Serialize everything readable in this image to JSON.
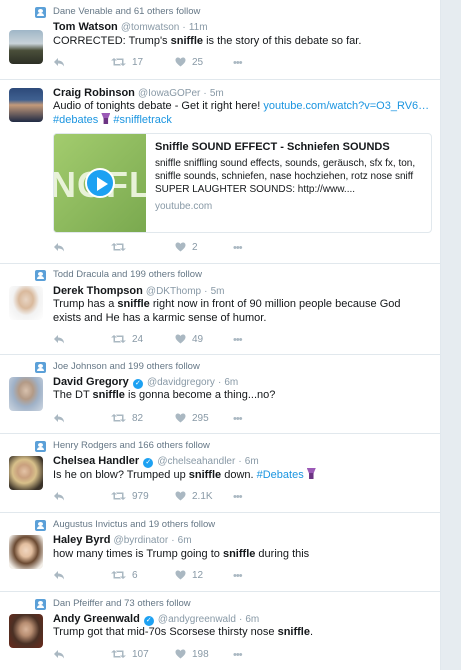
{
  "tweets": [
    {
      "context": "Dane Venable and 61 others follow",
      "name": "Tom Watson",
      "handle": "@tomwatson",
      "time": "11m",
      "text_parts": [
        {
          "t": "CORRECTED: Trump's ",
          "b": false
        },
        {
          "t": "sniffle",
          "b": true
        },
        {
          "t": " is the story of this debate so far.",
          "b": false
        }
      ],
      "retweets": "17",
      "likes": "25"
    },
    {
      "context": "",
      "name": "Craig Robinson",
      "handle": "@IowaGOPer",
      "time": "5m",
      "text_line1": "Audio of tonights debate - Get it right here! ",
      "text_link": "youtube.com/watch?v=O3_RV6…",
      "hashtag1": "#debates",
      "hashtag2": "#sniffletrack",
      "card": {
        "title": "Sniffle SOUND EFFECT - Schniefen SOUNDS",
        "description": "sniffle sniffling sound effects, sounds, geräusch, sfx fx, ton, sniffle sounds, schniefen, nase hochziehen, rotz nose sniff SUPER LAUGHTER SOUNDS: http://www....",
        "domain": "youtube.com",
        "thumb_text": "NOFL"
      },
      "retweets": "",
      "likes": "2"
    },
    {
      "context": "Todd Dracula and 199 others follow",
      "name": "Derek Thompson",
      "handle": "@DKThomp",
      "time": "5m",
      "text_parts": [
        {
          "t": "Trump has a ",
          "b": false
        },
        {
          "t": "sniffle",
          "b": true
        },
        {
          "t": " right now in front of 90 million people because God exists and He has a karmic sense of humor.",
          "b": false
        }
      ],
      "retweets": "24",
      "likes": "49"
    },
    {
      "context": "Joe Johnson and 199 others follow",
      "name": "David Gregory",
      "handle": "@davidgregory",
      "time": "6m",
      "verified": true,
      "text_parts": [
        {
          "t": "The DT ",
          "b": false
        },
        {
          "t": "sniffle",
          "b": true
        },
        {
          "t": " is gonna become a thing...no?",
          "b": false
        }
      ],
      "retweets": "82",
      "likes": "295"
    },
    {
      "context": "Henry Rodgers and 166 others follow",
      "name": "Chelsea Handler",
      "handle": "@chelseahandler",
      "time": "6m",
      "verified": true,
      "text_parts": [
        {
          "t": "Is he on blow? Trumped up ",
          "b": false
        },
        {
          "t": "sniffle",
          "b": true
        },
        {
          "t": " down. ",
          "b": false
        }
      ],
      "hashtag": "#Debates",
      "retweets": "979",
      "likes": "2.1K"
    },
    {
      "context": "Augustus Invictus and 19 others follow",
      "name": "Haley Byrd",
      "handle": "@byrdinator",
      "time": "6m",
      "text_parts": [
        {
          "t": "how many times is Trump going to ",
          "b": false
        },
        {
          "t": "sniffle",
          "b": true
        },
        {
          "t": " during this",
          "b": false
        }
      ],
      "retweets": "6",
      "likes": "12"
    },
    {
      "context": "Dan Pfeiffer and 73 others follow",
      "name": "Andy Greenwald",
      "handle": "@andygreenwald",
      "time": "6m",
      "verified": true,
      "text_parts": [
        {
          "t": "Trump got that mid-70s Scorsese thirsty nose ",
          "b": false
        },
        {
          "t": "sniffle",
          "b": true
        },
        {
          "t": ".",
          "b": false
        }
      ],
      "retweets": "107",
      "likes": "198"
    }
  ],
  "colors": {
    "link": "#1b95e0",
    "muted": "#8899a6",
    "icon": "#aab8c2",
    "context_icon": "#5ba0d8",
    "verified": "#1da1f2"
  },
  "symbols": {
    "dot": "·",
    "more": "•••",
    "verified_check": "✓"
  }
}
